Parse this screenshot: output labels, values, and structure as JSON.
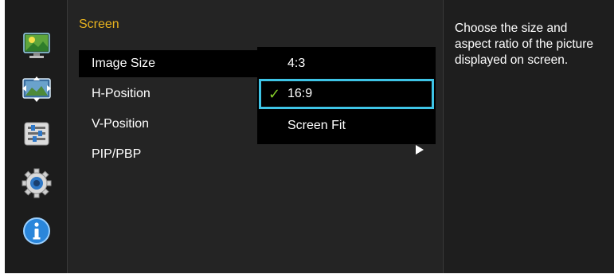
{
  "menu": {
    "title": "Screen",
    "items": [
      {
        "label": "Image Size"
      },
      {
        "label": "H-Position"
      },
      {
        "label": "V-Position"
      },
      {
        "label": "PIP/PBP"
      }
    ]
  },
  "submenu": {
    "options": [
      {
        "label": "4:3"
      },
      {
        "label": "16:9"
      },
      {
        "label": "Screen Fit"
      }
    ],
    "selected": "16:9",
    "check_mark": "✓"
  },
  "help": {
    "text": "Choose the size and aspect ratio of the picture displayed on screen."
  },
  "sidebar": {
    "icons": [
      "picture-icon",
      "screen-icon",
      "system-settings-icon",
      "settings-gear-icon",
      "information-icon"
    ]
  },
  "colors": {
    "title": "#e8b31f",
    "highlight_border": "#3ec4e6",
    "check": "#86cf2a",
    "background": "#232323"
  }
}
